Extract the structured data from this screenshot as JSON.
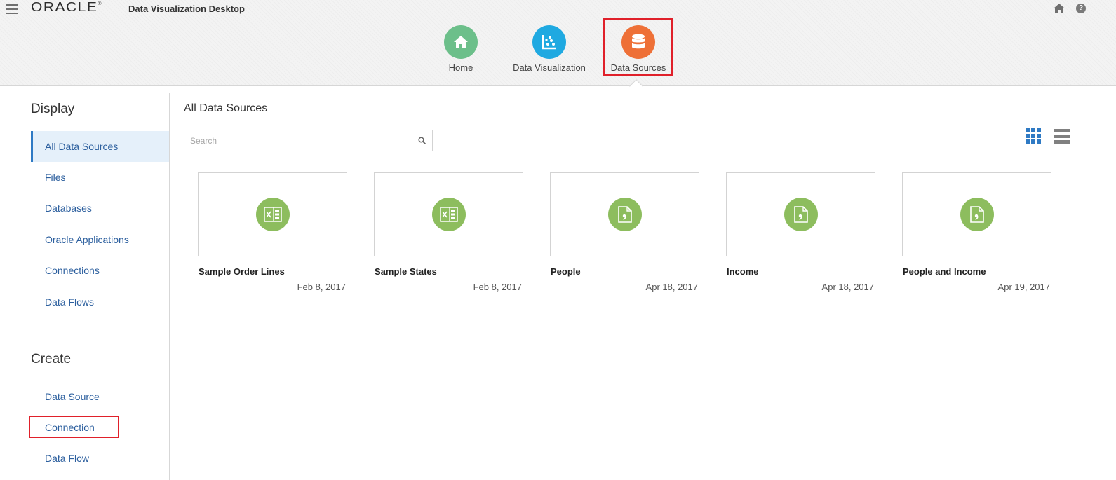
{
  "header": {
    "logo": "ORACLE",
    "app_title": "Data Visualization Desktop",
    "nav": [
      {
        "label": "Home",
        "icon": "home-icon",
        "color": "#6cbf8a"
      },
      {
        "label": "Data Visualization",
        "icon": "scatter-chart-icon",
        "color": "#1fa9e1"
      },
      {
        "label": "Data Sources",
        "icon": "database-icon",
        "color": "#ee7037",
        "selected": true
      }
    ]
  },
  "sidebar": {
    "display_heading": "Display",
    "display_items": [
      {
        "label": "All Data Sources",
        "active": true
      },
      {
        "label": "Files"
      },
      {
        "label": "Databases"
      },
      {
        "label": "Oracle Applications"
      },
      {
        "label": "Connections"
      },
      {
        "label": "Data Flows"
      }
    ],
    "create_heading": "Create",
    "create_items": [
      {
        "label": "Data Source"
      },
      {
        "label": "Connection",
        "highlighted": true
      },
      {
        "label": "Data Flow"
      }
    ]
  },
  "main": {
    "title": "All Data Sources",
    "search_placeholder": "Search",
    "view_modes": [
      "grid-view-icon",
      "list-view-icon"
    ],
    "active_view": "grid-view-icon",
    "cards": [
      {
        "name": "Sample Order Lines",
        "date": "Feb 8, 2017",
        "icon": "excel-file-icon"
      },
      {
        "name": "Sample States",
        "date": "Feb 8, 2017",
        "icon": "excel-file-icon"
      },
      {
        "name": "People",
        "date": "Apr 18, 2017",
        "icon": "csv-file-icon"
      },
      {
        "name": "Income",
        "date": "Apr 18, 2017",
        "icon": "csv-file-icon"
      },
      {
        "name": "People and Income",
        "date": "Apr 19, 2017",
        "icon": "csv-file-icon"
      }
    ]
  },
  "colors": {
    "accent": "#2f7ac4",
    "link": "#2c5f9e",
    "highlight_box": "#e0202a",
    "file_icon_bg": "#8dbd5e"
  }
}
